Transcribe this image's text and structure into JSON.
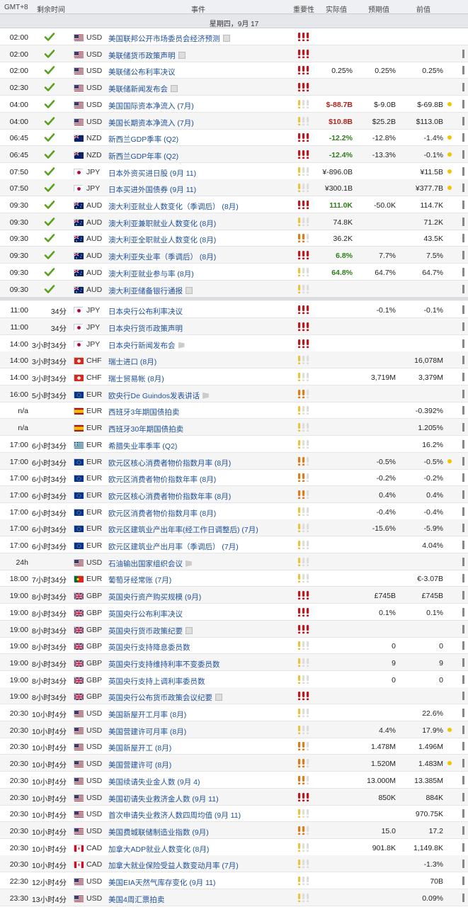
{
  "header": {
    "timezone": "GMT+8",
    "remaining": "剩余时间",
    "event": "事件",
    "importance": "重要性",
    "actual": "实际值",
    "forecast": "预期值",
    "previous": "前值"
  },
  "day_label": "星期四，9月 17",
  "colors": {
    "high": "#c0171f",
    "medium": "#e07b1a",
    "low": "#e9c33a",
    "check": "#5aa020",
    "positive": "#2f7d1a",
    "negative": "#b3231b",
    "dot": "#f2c500"
  },
  "rows_past": [
    {
      "time": "02:00",
      "cur": "USD",
      "flag": "us",
      "event": "美国联邦公开市场委员会经济预测",
      "icon": "doc",
      "imp": 3,
      "act": "",
      "act_cls": "",
      "fc": "",
      "prev": "",
      "dot": false,
      "bar": false
    },
    {
      "time": "02:00",
      "cur": "USD",
      "flag": "us",
      "event": "美联储货币政策声明",
      "icon": "doc",
      "imp": 3,
      "act": "",
      "act_cls": "",
      "fc": "",
      "prev": "",
      "dot": false,
      "bar": true
    },
    {
      "time": "02:00",
      "cur": "USD",
      "flag": "us",
      "event": "美联储公布利率决议",
      "icon": "",
      "imp": 3,
      "act": "0.25%",
      "act_cls": "",
      "fc": "0.25%",
      "prev": "0.25%",
      "dot": false,
      "bar": true
    },
    {
      "time": "02:30",
      "cur": "USD",
      "flag": "us",
      "event": "美联储新闻发布会",
      "icon": "doc",
      "imp": 3,
      "act": "",
      "act_cls": "",
      "fc": "",
      "prev": "",
      "dot": false,
      "bar": true
    },
    {
      "time": "04:00",
      "cur": "USD",
      "flag": "us",
      "event": "美国国际资本净流入 (7月)",
      "icon": "",
      "imp": 1,
      "act": "$-88.7B",
      "act_cls": "down",
      "fc": "$-9.0B",
      "prev": "$-69.8B",
      "dot": true,
      "bar": true
    },
    {
      "time": "04:00",
      "cur": "USD",
      "flag": "us",
      "event": "美国长期资本净流入 (7月)",
      "icon": "",
      "imp": 1,
      "act": "$10.8B",
      "act_cls": "down",
      "fc": "$25.2B",
      "prev": "$113.0B",
      "dot": false,
      "bar": true
    },
    {
      "time": "06:45",
      "cur": "NZD",
      "flag": "nz",
      "event": "新西兰GDP季率 (Q2)",
      "icon": "",
      "imp": 3,
      "act": "-12.2%",
      "act_cls": "up",
      "fc": "-12.8%",
      "prev": "-1.4%",
      "dot": true,
      "bar": true
    },
    {
      "time": "06:45",
      "cur": "NZD",
      "flag": "nz",
      "event": "新西兰GDP年率 (Q2)",
      "icon": "",
      "imp": 3,
      "act": "-12.4%",
      "act_cls": "up",
      "fc": "-13.3%",
      "prev": "-0.1%",
      "dot": true,
      "bar": true
    },
    {
      "time": "07:50",
      "cur": "JPY",
      "flag": "jp",
      "event": "日本外资买进日股 (9月 11)",
      "icon": "",
      "imp": 1,
      "act": "¥-896.0B",
      "act_cls": "",
      "fc": "",
      "prev": "¥11.5B",
      "dot": true,
      "bar": true
    },
    {
      "time": "07:50",
      "cur": "JPY",
      "flag": "jp",
      "event": "日本买进外国债券 (9月 11)",
      "icon": "",
      "imp": 1,
      "act": "¥300.1B",
      "act_cls": "",
      "fc": "",
      "prev": "¥377.7B",
      "dot": true,
      "bar": true
    },
    {
      "time": "09:30",
      "cur": "AUD",
      "flag": "au",
      "event": "澳大利亚就业人数变化（季调后） (8月)",
      "icon": "",
      "imp": 3,
      "act": "111.0K",
      "act_cls": "up",
      "fc": "-50.0K",
      "prev": "114.7K",
      "dot": false,
      "bar": true
    },
    {
      "time": "09:30",
      "cur": "AUD",
      "flag": "au",
      "event": "澳大利亚兼职就业人数变化 (8月)",
      "icon": "",
      "imp": 1,
      "act": "74.8K",
      "act_cls": "",
      "fc": "",
      "prev": "71.2K",
      "dot": false,
      "bar": true
    },
    {
      "time": "09:30",
      "cur": "AUD",
      "flag": "au",
      "event": "澳大利亚全职就业人数变化 (8月)",
      "icon": "",
      "imp": 2,
      "act": "36.2K",
      "act_cls": "",
      "fc": "",
      "prev": "43.5K",
      "dot": false,
      "bar": true
    },
    {
      "time": "09:30",
      "cur": "AUD",
      "flag": "au",
      "event": "澳大利亚失业率（季调后） (8月)",
      "icon": "",
      "imp": 3,
      "act": "6.8%",
      "act_cls": "up",
      "fc": "7.7%",
      "prev": "7.5%",
      "dot": false,
      "bar": true
    },
    {
      "time": "09:30",
      "cur": "AUD",
      "flag": "au",
      "event": "澳大利亚就业参与率 (8月)",
      "icon": "",
      "imp": 1,
      "act": "64.8%",
      "act_cls": "up",
      "fc": "64.7%",
      "prev": "64.7%",
      "dot": false,
      "bar": true
    },
    {
      "time": "09:30",
      "cur": "AUD",
      "flag": "au",
      "event": "澳大利亚储备银行通报",
      "icon": "doc",
      "imp": 1,
      "act": "",
      "act_cls": "",
      "fc": "",
      "prev": "",
      "dot": false,
      "bar": true
    }
  ],
  "rows_future": [
    {
      "time": "11:00",
      "rem": "34分",
      "cur": "JPY",
      "flag": "jp",
      "event": "日本央行公布利率决议",
      "icon": "",
      "imp": 3,
      "fc": "-0.1%",
      "prev": "-0.1%",
      "dot": false,
      "bar": true
    },
    {
      "time": "11:00",
      "rem": "34分",
      "cur": "JPY",
      "flag": "jp",
      "event": "日本央行货币政策声明",
      "icon": "",
      "imp": 3,
      "fc": "",
      "prev": "",
      "dot": false,
      "bar": true
    },
    {
      "time": "14:00",
      "rem": "3小时34分",
      "cur": "JPY",
      "flag": "jp",
      "event": "日本央行新闻发布会",
      "icon": "flag",
      "imp": 3,
      "fc": "",
      "prev": "",
      "dot": false,
      "bar": true
    },
    {
      "time": "14:00",
      "rem": "3小时34分",
      "cur": "CHF",
      "flag": "ch",
      "event": "瑞士进口 (8月)",
      "icon": "",
      "imp": 1,
      "fc": "",
      "prev": "16,078M",
      "dot": false,
      "bar": true
    },
    {
      "time": "14:00",
      "rem": "3小时34分",
      "cur": "CHF",
      "flag": "ch",
      "event": "瑞士贸易帐 (8月)",
      "icon": "",
      "imp": 1,
      "fc": "3,719M",
      "prev": "3,379M",
      "dot": false,
      "bar": true
    },
    {
      "time": "16:00",
      "rem": "5小时34分",
      "cur": "EUR",
      "flag": "eu",
      "event": "欧央行De Guindos发表讲话",
      "icon": "flag",
      "imp": 2,
      "fc": "",
      "prev": "",
      "dot": false,
      "bar": true
    },
    {
      "time": "n/a",
      "rem": "",
      "cur": "EUR",
      "flag": "es",
      "event": "西班牙3年期国债拍卖",
      "icon": "",
      "imp": 1,
      "fc": "",
      "prev": "-0.392%",
      "dot": false,
      "bar": true
    },
    {
      "time": "n/a",
      "rem": "",
      "cur": "EUR",
      "flag": "es",
      "event": "西班牙30年期国债拍卖",
      "icon": "",
      "imp": 1,
      "fc": "",
      "prev": "1.205%",
      "dot": false,
      "bar": true
    },
    {
      "time": "17:00",
      "rem": "6小时34分",
      "cur": "EUR",
      "flag": "gr",
      "event": "希腊失业率季率 (Q2)",
      "icon": "",
      "imp": 1,
      "fc": "",
      "prev": "16.2%",
      "dot": false,
      "bar": true
    },
    {
      "time": "17:00",
      "rem": "6小时34分",
      "cur": "EUR",
      "flag": "eu",
      "event": "欧元区核心消费者物价指数月率 (8月)",
      "icon": "",
      "imp": 2,
      "fc": "-0.5%",
      "prev": "-0.5%",
      "dot": true,
      "bar": true
    },
    {
      "time": "17:00",
      "rem": "6小时34分",
      "cur": "EUR",
      "flag": "eu",
      "event": "欧元区消费者物价指数年率 (8月)",
      "icon": "",
      "imp": 2,
      "fc": "-0.2%",
      "prev": "-0.2%",
      "dot": false,
      "bar": true
    },
    {
      "time": "17:00",
      "rem": "6小时34分",
      "cur": "EUR",
      "flag": "eu",
      "event": "欧元区核心消费者物价指数年率 (8月)",
      "icon": "",
      "imp": 2,
      "fc": "0.4%",
      "prev": "0.4%",
      "dot": false,
      "bar": true
    },
    {
      "time": "17:00",
      "rem": "6小时34分",
      "cur": "EUR",
      "flag": "eu",
      "event": "欧元区消费者物价指数月率 (8月)",
      "icon": "",
      "imp": 1,
      "fc": "-0.4%",
      "prev": "-0.4%",
      "dot": false,
      "bar": true
    },
    {
      "time": "17:00",
      "rem": "6小时34分",
      "cur": "EUR",
      "flag": "eu",
      "event": "欧元区建筑业产出年率(经工作日调整后) (7月)",
      "icon": "",
      "imp": 1,
      "fc": "-15.6%",
      "prev": "-5.9%",
      "dot": false,
      "bar": true
    },
    {
      "time": "17:00",
      "rem": "6小时34分",
      "cur": "EUR",
      "flag": "eu",
      "event": "欧元区建筑业产出月率（季调后） (7月)",
      "icon": "",
      "imp": 1,
      "fc": "",
      "prev": "4.04%",
      "dot": false,
      "bar": true
    },
    {
      "time": "24h",
      "rem": "",
      "cur": "USD",
      "flag": "us",
      "event": "石油输出国家组织会议",
      "icon": "flag",
      "imp": 1,
      "fc": "",
      "prev": "",
      "dot": false,
      "bar": true
    },
    {
      "time": "18:00",
      "rem": "7小时34分",
      "cur": "EUR",
      "flag": "pt",
      "event": "葡萄牙经常账 (7月)",
      "icon": "",
      "imp": 1,
      "fc": "",
      "prev": "€-3.07B",
      "dot": false,
      "bar": true
    },
    {
      "time": "19:00",
      "rem": "8小时34分",
      "cur": "GBP",
      "flag": "gb",
      "event": "英国央行资产购买规模 (9月)",
      "icon": "",
      "imp": 3,
      "fc": "£745B",
      "prev": "£745B",
      "dot": false,
      "bar": true
    },
    {
      "time": "19:00",
      "rem": "8小时34分",
      "cur": "GBP",
      "flag": "gb",
      "event": "英国央行公布利率决议",
      "icon": "",
      "imp": 3,
      "fc": "0.1%",
      "prev": "0.1%",
      "dot": false,
      "bar": true
    },
    {
      "time": "19:00",
      "rem": "8小时34分",
      "cur": "GBP",
      "flag": "gb",
      "event": "英国央行货币政策纪要",
      "icon": "doc",
      "imp": 3,
      "fc": "",
      "prev": "",
      "dot": false,
      "bar": true
    },
    {
      "time": "19:00",
      "rem": "8小时34分",
      "cur": "GBP",
      "flag": "gb",
      "event": "英国央行支持降息委员数",
      "icon": "",
      "imp": 1,
      "fc": "0",
      "prev": "0",
      "dot": false,
      "bar": true
    },
    {
      "time": "19:00",
      "rem": "8小时34分",
      "cur": "GBP",
      "flag": "gb",
      "event": "英国央行支持维持利率不变委员数",
      "icon": "",
      "imp": 1,
      "fc": "9",
      "prev": "9",
      "dot": false,
      "bar": true
    },
    {
      "time": "19:00",
      "rem": "8小时34分",
      "cur": "GBP",
      "flag": "gb",
      "event": "英国央行支持上调利率委员数",
      "icon": "",
      "imp": 1,
      "fc": "0",
      "prev": "0",
      "dot": false,
      "bar": true
    },
    {
      "time": "19:00",
      "rem": "8小时34分",
      "cur": "GBP",
      "flag": "gb",
      "event": "英国央行公布货币政策会议纪要",
      "icon": "doc",
      "imp": 3,
      "fc": "",
      "prev": "",
      "dot": false,
      "bar": true
    },
    {
      "time": "20:30",
      "rem": "10小时4分",
      "cur": "USD",
      "flag": "us",
      "event": "美国新屋开工月率 (8月)",
      "icon": "",
      "imp": 1,
      "fc": "",
      "prev": "22.6%",
      "dot": false,
      "bar": true
    },
    {
      "time": "20:30",
      "rem": "10小时4分",
      "cur": "USD",
      "flag": "us",
      "event": "美国营建许可月率 (8月)",
      "icon": "",
      "imp": 1,
      "fc": "4.4%",
      "prev": "17.9%",
      "dot": true,
      "bar": true
    },
    {
      "time": "20:30",
      "rem": "10小时4分",
      "cur": "USD",
      "flag": "us",
      "event": "美国新屋开工 (8月)",
      "icon": "",
      "imp": 2,
      "fc": "1.478M",
      "prev": "1.496M",
      "dot": false,
      "bar": true
    },
    {
      "time": "20:30",
      "rem": "10小时4分",
      "cur": "USD",
      "flag": "us",
      "event": "美国营建许可 (8月)",
      "icon": "",
      "imp": 2,
      "fc": "1.520M",
      "prev": "1.483M",
      "dot": true,
      "bar": true
    },
    {
      "time": "20:30",
      "rem": "10小时4分",
      "cur": "USD",
      "flag": "us",
      "event": "美国续请失业金人数 (9月 4)",
      "icon": "",
      "imp": 2,
      "fc": "13.000M",
      "prev": "13.385M",
      "dot": false,
      "bar": true
    },
    {
      "time": "20:30",
      "rem": "10小时4分",
      "cur": "USD",
      "flag": "us",
      "event": "美国初请失业救济金人数 (9月 11)",
      "icon": "",
      "imp": 3,
      "fc": "850K",
      "prev": "884K",
      "dot": false,
      "bar": true
    },
    {
      "time": "20:30",
      "rem": "10小时4分",
      "cur": "USD",
      "flag": "us",
      "event": "首次申请失业救济人数四周均值 (9月 11)",
      "icon": "",
      "imp": 1,
      "fc": "",
      "prev": "970.75K",
      "dot": false,
      "bar": true
    },
    {
      "time": "20:30",
      "rem": "10小时4分",
      "cur": "USD",
      "flag": "us",
      "event": "美国费城联储制造业指数 (9月)",
      "icon": "",
      "imp": 2,
      "fc": "15.0",
      "prev": "17.2",
      "dot": false,
      "bar": true
    },
    {
      "time": "20:30",
      "rem": "10小时4分",
      "cur": "CAD",
      "flag": "ca",
      "event": "加拿大ADP就业人数变化 (8月)",
      "icon": "",
      "imp": 1,
      "fc": "901.8K",
      "prev": "1,149.8K",
      "dot": false,
      "bar": true
    },
    {
      "time": "20:30",
      "rem": "10小时4分",
      "cur": "CAD",
      "flag": "ca",
      "event": "加拿大就业保险受益人数变动月率 (7月)",
      "icon": "",
      "imp": 1,
      "fc": "",
      "prev": "-1.3%",
      "dot": false,
      "bar": true
    },
    {
      "time": "22:30",
      "rem": "12小时4分",
      "cur": "USD",
      "flag": "us",
      "event": "美国EIA天然气库存变化 (9月 11)",
      "icon": "",
      "imp": 1,
      "fc": "",
      "prev": "70B",
      "dot": false,
      "bar": true
    },
    {
      "time": "23:30",
      "rem": "13小时4分",
      "cur": "USD",
      "flag": "us",
      "event": "美国4周汇票拍卖",
      "icon": "",
      "imp": 1,
      "fc": "",
      "prev": "0.09%",
      "dot": false,
      "bar": true
    }
  ]
}
